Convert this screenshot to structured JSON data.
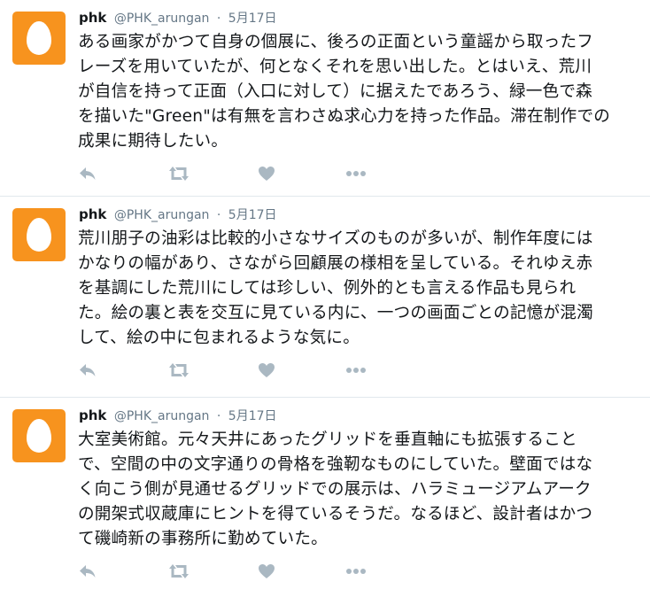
{
  "tweets": [
    {
      "name": "phk",
      "handle": "@PHK_arungan",
      "separator": "·",
      "time": "5月17日",
      "text": "ある画家がかつて自身の個展に、後ろの正面という童謡から取ったフ\nレーズを用いていたが、何となくそれを思い出した。とはいえ、荒川\nが自信を持って正面（入口に対して）に据えたであろう、緑一色で森\nを描いた\"Green\"は有無を言わさぬ求心力を持った作品。滞在制作での\n成果に期待したい。"
    },
    {
      "name": "phk",
      "handle": "@PHK_arungan",
      "separator": "·",
      "time": "5月17日",
      "text": "荒川朋子の油彩は比較的小さなサイズのものが多いが、制作年度には\nかなりの幅があり、さながら回顧展の様相を呈している。それゆえ赤\nを基調にした荒川にしては珍しい、例外的とも言える作品も見られ\nた。絵の裏と表を交互に見ている内に、一つの画面ごとの記憶が混濁\nして、絵の中に包まれるような気に。"
    },
    {
      "name": "phk",
      "handle": "@PHK_arungan",
      "separator": "·",
      "time": "5月17日",
      "text": "大室美術館。元々天井にあったグリッドを垂直軸にも拡張すること\nで、空間の中の文字通りの骨格を強靭なものにしていた。壁面ではな\nく向こう側が見通せるグリッドでの展示は、ハラミュージアムアーク\nの開架式収蔵庫にヒントを得ているそうだ。なるほど、設計者はかつ\nて磯崎新の事務所に勤めていた。"
    }
  ],
  "icons": {
    "avatar": "egg-avatar",
    "reply": "reply-icon",
    "retweet": "retweet-icon",
    "like": "heart-icon",
    "more": "more-dots-icon"
  },
  "colors": {
    "avatar_bg": "#f7931e",
    "action_icon": "#aab8c2",
    "meta_text": "#657786",
    "divider": "#e1e8ed"
  }
}
